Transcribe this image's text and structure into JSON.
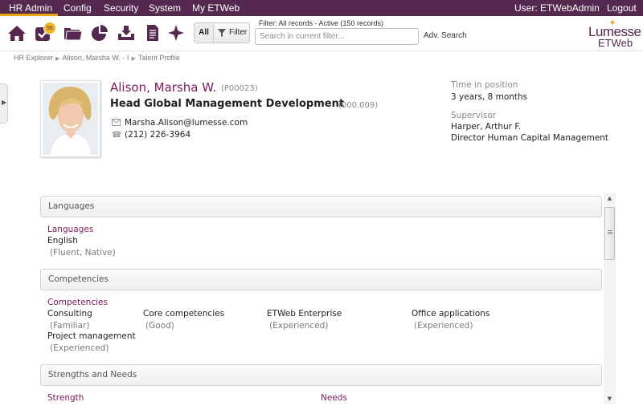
{
  "menu": {
    "items": [
      "HR Admin",
      "Config",
      "Security",
      "System",
      "My ETWeb"
    ],
    "user": "User: ETWebAdmin",
    "logout": "Logout",
    "accent": "#55284f",
    "active_color": "#e8a317"
  },
  "toolbar": {
    "icons": [
      "home-icon",
      "tasks-icon",
      "folders-icon",
      "reports-icon",
      "download-icon",
      "document-icon",
      "sparkle-icon"
    ],
    "badge_count": "56",
    "all_label": "All",
    "filter_label": "Filter",
    "filter_status": "Filter: All records - Active (150 records)",
    "search_placeholder": "Search in current filter...",
    "adv_search": "Adv. Search"
  },
  "logo": {
    "line1": "Lumesse",
    "line2": "ETWeb"
  },
  "breadcrumb": [
    "HR Explorer",
    "Alison, Marsha W. - I",
    "Talent Profile"
  ],
  "profile": {
    "name": "Alison, Marsha W.",
    "id": "(P00023)",
    "job_title": "Head Global Management Development",
    "job_id": "(000.009)",
    "email": "Marsha.Alison@lumesse.com",
    "phone": "(212) 226-3964",
    "time_in_position_label": "Time in position",
    "time_in_position": "3 years, 8 months",
    "supervisor_label": "Supervisor",
    "supervisor_name": "Harper, Arthur F.",
    "supervisor_title": "Director Human Capital Management"
  },
  "sections": {
    "languages": {
      "header": "Languages",
      "title": "Languages",
      "items": [
        {
          "name": "English",
          "level": "(Fluent, Native)"
        }
      ]
    },
    "competencies": {
      "header": "Competencies",
      "title": "Competencies",
      "items": [
        {
          "name": "Consulting",
          "level": "(Familiar)"
        },
        {
          "name": "Core competencies",
          "level": "(Good)"
        },
        {
          "name": "ETWeb Enterprise",
          "level": "(Experienced)"
        },
        {
          "name": "Office applications",
          "level": "(Experienced)"
        },
        {
          "name": "Project management",
          "level": "(Experienced)"
        }
      ]
    },
    "strengths": {
      "header": "Strengths and Needs",
      "strength_title": "Strength",
      "needs_title": "Needs"
    }
  }
}
